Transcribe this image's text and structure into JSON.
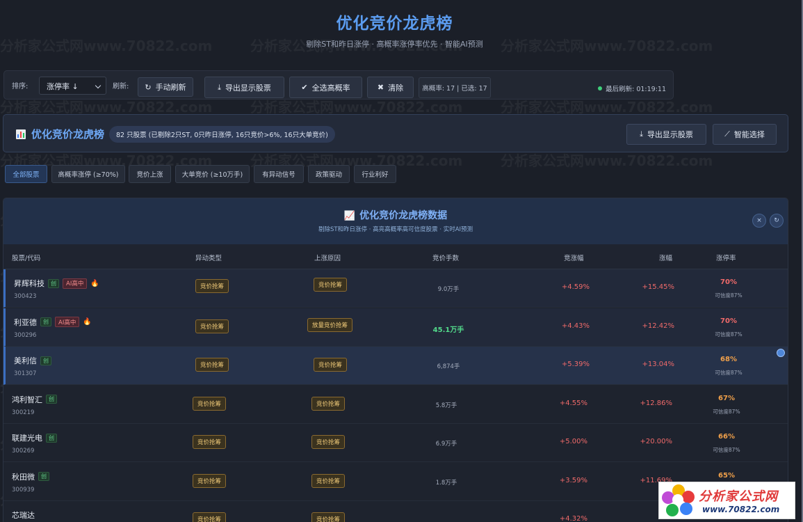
{
  "header": {
    "title": "优化竞价龙虎榜",
    "subtitle": "剔除ST和昨日涨停 · 高概率涨停率优先 · 智能AI预测"
  },
  "toolbar": {
    "sort_label": "排序:",
    "sort_value": "涨停率 ↓",
    "refresh_label": "刷新:",
    "manual_refresh": "手动刷新",
    "export": "导出显示股票",
    "select_high": "全选高概率",
    "clear": "清除",
    "counts": "高概率: 17 | 已选: 17",
    "last_refresh": "最后刷新: 01:19:11"
  },
  "board": {
    "title": "优化竞价龙虎榜",
    "badge": "82 只股票 (已剔除2只ST, 0只昨日涨停, 16只竞价>6%, 16只大单竞价)",
    "export": "导出显示股票",
    "smart": "智能选择"
  },
  "filters": [
    "全部股票",
    "高概率涨停 (≥70%)",
    "竞价上涨",
    "大单竞价 (≥10万手)",
    "有异动信号",
    "政策驱动",
    "行业利好"
  ],
  "panel": {
    "title": "优化竞价龙虎榜数据",
    "subtitle": "剔除ST和昨日涨停 · 高亮高概率高可信度股票 · 实时AI预测",
    "close": "×",
    "refresh": "↻"
  },
  "table": {
    "headers": [
      "股票/代码",
      "异动类型",
      "上涨原因",
      "竞价手数",
      "竞涨幅",
      "涨幅",
      "涨停率"
    ],
    "rows": [
      {
        "name": "昇辉科技",
        "code": "300423",
        "board": "创",
        "ai": "AI高中",
        "fire": "🔥",
        "type": "竞价抢筹",
        "reason": "竞价抢筹",
        "volume": "9.0万手",
        "auction": "+4.59%",
        "change": "+15.45%",
        "rate": "70%",
        "conf": "可信度87%"
      },
      {
        "name": "利亚德",
        "code": "300296",
        "board": "创",
        "ai": "AI高中",
        "fire": "🔥",
        "type": "竞价抢筹",
        "reason": "放量竞价抢筹",
        "volume": "45.1万手",
        "auction": "+4.43%",
        "change": "+12.42%",
        "rate": "70%",
        "conf": "可信度87%"
      },
      {
        "name": "美利信",
        "code": "301307",
        "board": "创",
        "ai": "",
        "fire": "",
        "type": "竞价抢筹",
        "reason": "竞价抢筹",
        "volume": "6,874手",
        "auction": "+5.39%",
        "change": "+13.04%",
        "rate": "68%",
        "conf": "可信度87%"
      },
      {
        "name": "鸿利智汇",
        "code": "300219",
        "board": "创",
        "ai": "",
        "fire": "",
        "type": "竞价抢筹",
        "reason": "竞价抢筹",
        "volume": "5.8万手",
        "auction": "+4.55%",
        "change": "+12.86%",
        "rate": "67%",
        "conf": "可信度87%"
      },
      {
        "name": "联建光电",
        "code": "300269",
        "board": "创",
        "ai": "",
        "fire": "",
        "type": "竞价抢筹",
        "reason": "竞价抢筹",
        "volume": "6.9万手",
        "auction": "+5.00%",
        "change": "+20.00%",
        "rate": "66%",
        "conf": "可信度87%"
      },
      {
        "name": "秋田微",
        "code": "300939",
        "board": "创",
        "ai": "",
        "fire": "",
        "type": "竞价抢筹",
        "reason": "竞价抢筹",
        "volume": "1.8万手",
        "auction": "+3.59%",
        "change": "+11.69%",
        "rate": "65%",
        "conf": ""
      },
      {
        "name": "芯瑞达",
        "code": "",
        "board": "",
        "ai": "",
        "fire": "",
        "type": "竞价抢筹",
        "reason": "竞价抢筹",
        "volume": "",
        "auction": "+4.32%",
        "change": "",
        "rate": "",
        "conf": ""
      }
    ]
  },
  "watermark": "分析家公式网www.70822.com",
  "logo": {
    "name": "分析家公式网",
    "url": "www.70822.com"
  },
  "colors": {
    "accent": "#5b9cf0",
    "up": "#f06a6a",
    "warn": "#f0a04a",
    "green": "#52d88a",
    "bg": "#1b1f28"
  }
}
